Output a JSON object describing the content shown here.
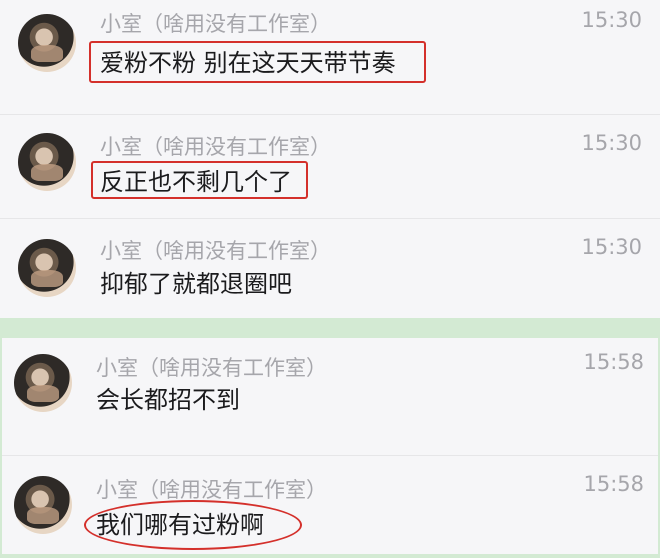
{
  "messages": [
    {
      "sender": "小室（啥用没有工作室）",
      "time": "15:30",
      "text": "爱粉不粉 别在这天天带节奏",
      "avatar": "user-avatar"
    },
    {
      "sender": "小室（啥用没有工作室）",
      "time": "15:30",
      "text": "反正也不剩几个了",
      "avatar": "user-avatar"
    },
    {
      "sender": "小室（啥用没有工作室）",
      "time": "15:30",
      "text": "抑郁了就都退圈吧",
      "avatar": "user-avatar"
    },
    {
      "sender": "小室（啥用没有工作室）",
      "time": "15:58",
      "text": "会长都招不到",
      "avatar": "user-avatar"
    },
    {
      "sender": "小室（啥用没有工作室）",
      "time": "15:58",
      "text": "我们哪有过粉啊",
      "avatar": "user-avatar"
    }
  ],
  "colors": {
    "background": "#d3ead3",
    "panel": "#f6f6f8",
    "meta_text": "#a6a6ab",
    "body_text": "#1b1b1d",
    "highlight": "#d4302b"
  }
}
